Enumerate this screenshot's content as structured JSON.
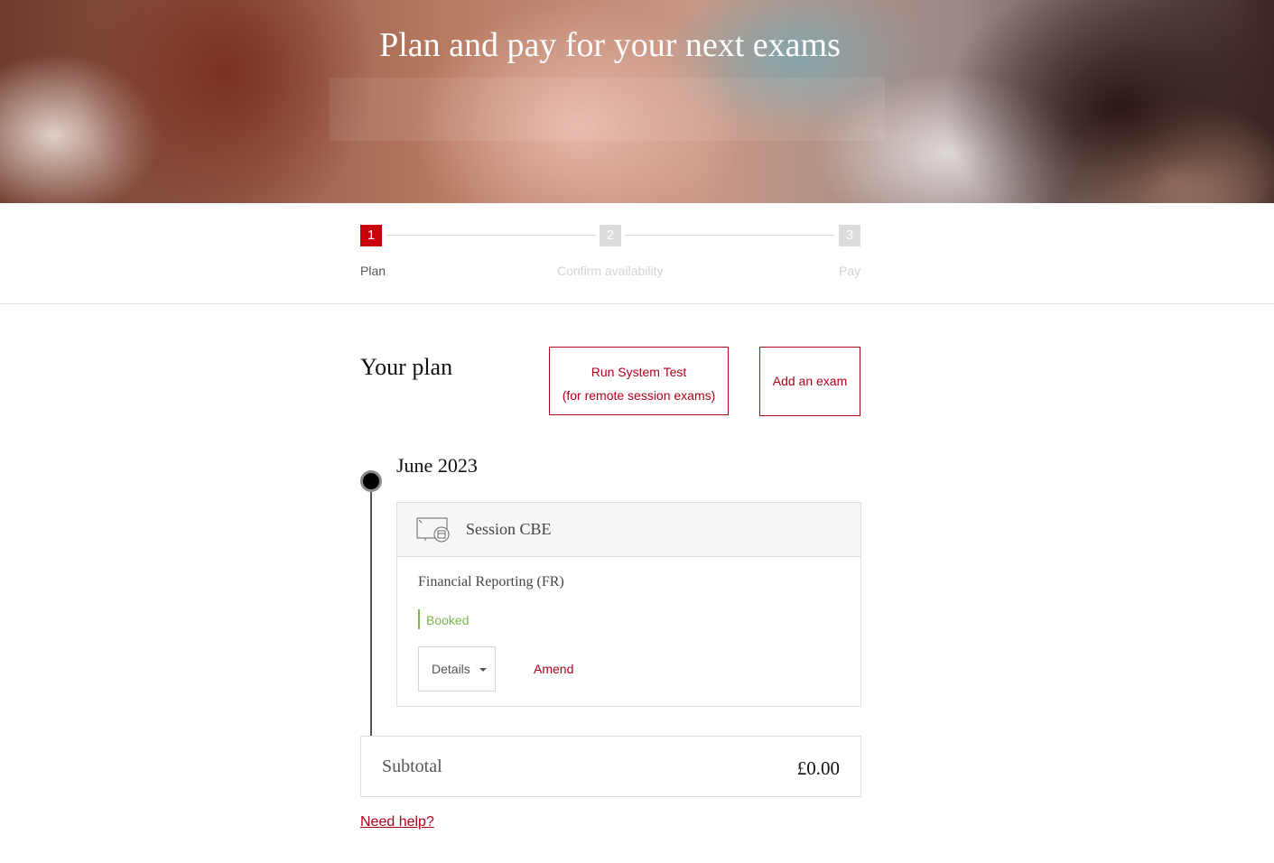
{
  "hero": {
    "title": "Plan and pay for your next exams"
  },
  "steps": [
    {
      "number": "1",
      "label": "Plan",
      "active": true
    },
    {
      "number": "2",
      "label": "Confirm availability",
      "active": false
    },
    {
      "number": "3",
      "label": "Pay",
      "active": false
    }
  ],
  "plan": {
    "title": "Your plan",
    "run_test_line1": "Run System Test",
    "run_test_line2": "(for remote session exams)",
    "add_exam_label": "Add an exam"
  },
  "timeline": {
    "month": "June 2023",
    "session": {
      "type": "Session CBE",
      "icon": "computer-calendar-icon",
      "exam": "Financial Reporting (FR)",
      "status": "Booked",
      "details_label": "Details",
      "amend_label": "Amend"
    }
  },
  "subtotal": {
    "label": "Subtotal",
    "value": "£0.00"
  },
  "help": {
    "label": "Need help?"
  },
  "colors": {
    "accent": "#b1001a",
    "active_step": "#c8000c",
    "booked": "#7ab648"
  }
}
